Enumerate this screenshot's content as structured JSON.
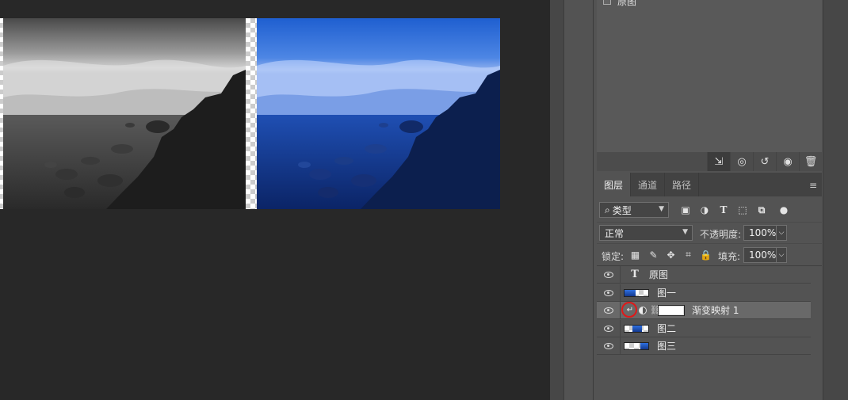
{
  "history": {
    "item_label": "原图",
    "toolbar_icons": [
      "new-document-from-state-icon",
      "snapshot-icon",
      "undo-icon",
      "eye-icon",
      "trash-icon"
    ]
  },
  "layers_panel": {
    "tabs": [
      {
        "label": "图层",
        "active": true
      },
      {
        "label": "通道",
        "active": false
      },
      {
        "label": "路径",
        "active": false
      }
    ],
    "filter": {
      "search_glyph": "⌕",
      "kind": "类型"
    },
    "filter_icons": [
      "image-filter-icon",
      "adjustment-filter-icon",
      "type-filter-icon",
      "shape-filter-icon",
      "smart-object-filter-icon",
      "filter-toggle-icon"
    ],
    "blend_mode": "正常",
    "opacity_label": "不透明度:",
    "opacity_value": "100%",
    "lock_label": "锁定:",
    "lock_icons": [
      "lock-transparent-icon",
      "lock-image-icon",
      "lock-position-icon",
      "lock-artboard-icon",
      "lock-all-icon"
    ],
    "fill_label": "填充:",
    "fill_value": "100%",
    "layers": [
      {
        "name": "原图",
        "kind": "type",
        "visible": true,
        "selected": false
      },
      {
        "name": "图一",
        "kind": "image",
        "visible": true,
        "selected": false
      },
      {
        "name": "渐变映射 1",
        "kind": "adjustment",
        "visible": true,
        "selected": true,
        "clipped": true
      },
      {
        "name": "图二",
        "kind": "image",
        "visible": true,
        "selected": false
      },
      {
        "name": "图三",
        "kind": "image",
        "visible": true,
        "selected": false
      }
    ]
  },
  "colors": {
    "canvas_bg": "#282828",
    "panel_bg": "#535353",
    "selected_row": "#696969",
    "highlight_circle": "#e01818",
    "photo_blue": "#2f6fdc"
  }
}
